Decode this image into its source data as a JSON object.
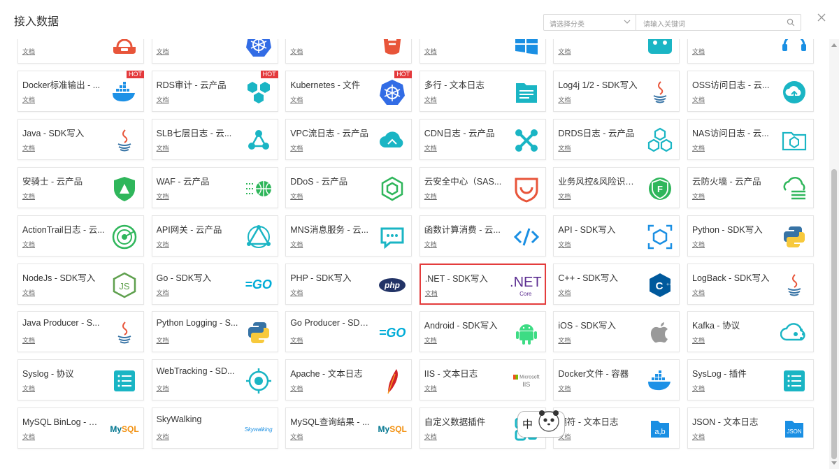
{
  "dialog": {
    "title": "接入数据",
    "category_placeholder": "请选择分类",
    "search_placeholder": "请输入关键词"
  },
  "ime": {
    "label": "中"
  },
  "hot_label": "HOT",
  "cards": [
    {
      "name": "",
      "doc": "文档",
      "icon": "alarm-icon",
      "color": "#e8553a"
    },
    {
      "name": "",
      "doc": "文档",
      "icon": "kubernetes-icon",
      "color": "#326ce5"
    },
    {
      "name": "",
      "doc": "文档",
      "icon": "bucket-icon",
      "color": "#e8553a"
    },
    {
      "name": "",
      "doc": "文档",
      "icon": "windows-icon",
      "color": "#1a8fe3"
    },
    {
      "name": "",
      "doc": "文档",
      "icon": "cloud-box-icon",
      "color": "#1ab5c4"
    },
    {
      "name": "",
      "doc": "文档",
      "icon": "headset-icon",
      "color": "#1a8fe3"
    },
    {
      "name": "Docker标准输出 - ...",
      "doc": "文档",
      "icon": "docker-icon",
      "color": "#1d91e6",
      "hot": true
    },
    {
      "name": "RDS审计 - 云产品",
      "doc": "文档",
      "icon": "hexagons-icon",
      "color": "#1ab5c4",
      "hot": true
    },
    {
      "name": "Kubernetes - 文件",
      "doc": "文档",
      "icon": "kubernetes-icon",
      "color": "#326ce5",
      "hot": true
    },
    {
      "name": "多行 - 文本日志",
      "doc": "文档",
      "icon": "file-lines-icon",
      "color": "#1ab5c4"
    },
    {
      "name": "Log4j 1/2 - SDK写入",
      "doc": "文档",
      "icon": "java-icon",
      "color": "#e8553a"
    },
    {
      "name": "OSS访问日志 - 云...",
      "doc": "文档",
      "icon": "cloud-upload-icon",
      "color": "#1ab5c4"
    },
    {
      "name": "Java - SDK写入",
      "doc": "文档",
      "icon": "java-icon",
      "color": "#e8553a"
    },
    {
      "name": "SLB七层日志 - 云...",
      "doc": "文档",
      "icon": "nodes-icon",
      "color": "#1ab5c4"
    },
    {
      "name": "VPC流日志 - 云产品",
      "doc": "文档",
      "icon": "cloud-flow-icon",
      "color": "#1ab5c4"
    },
    {
      "name": "CDN日志 - 云产品",
      "doc": "文档",
      "icon": "cross-nodes-icon",
      "color": "#1ab5c4"
    },
    {
      "name": "DRDS日志 - 云产品",
      "doc": "文档",
      "icon": "hexagon-stack-icon",
      "color": "#1ab5c4"
    },
    {
      "name": "NAS访问日志 - 云...",
      "doc": "文档",
      "icon": "folder-icon",
      "color": "#1ab5c4"
    },
    {
      "name": "安骑士 - 云产品",
      "doc": "文档",
      "icon": "shield-icon",
      "color": "#2fb65b"
    },
    {
      "name": "WAF - 云产品",
      "doc": "文档",
      "icon": "firewall-icon",
      "color": "#2fb65b"
    },
    {
      "name": "DDoS - 云产品",
      "doc": "文档",
      "icon": "cube-icon",
      "color": "#2fb65b"
    },
    {
      "name": "云安全中心（SAS...",
      "doc": "文档",
      "icon": "security-badge-icon",
      "color": "#e8553a"
    },
    {
      "name": "业务风控&风险识别...",
      "doc": "文档",
      "icon": "risk-shield-icon",
      "color": "#2fb65b"
    },
    {
      "name": "云防火墙 - 云产品",
      "doc": "文档",
      "icon": "cloud-firewall-icon",
      "color": "#2fb65b"
    },
    {
      "name": "ActionTrail日志 - 云...",
      "doc": "文档",
      "icon": "radar-icon",
      "color": "#2fb65b"
    },
    {
      "name": "API网关 - 云产品",
      "doc": "文档",
      "icon": "triangle-nodes-icon",
      "color": "#1ab5c4"
    },
    {
      "name": "MNS消息服务 - 云...",
      "doc": "文档",
      "icon": "message-icon",
      "color": "#1ab5c4"
    },
    {
      "name": "函数计算消费 - 云...",
      "doc": "文档",
      "icon": "function-icon",
      "color": "#1a8fe3"
    },
    {
      "name": "API - SDK写入",
      "doc": "文档",
      "icon": "api-cube-icon",
      "color": "#1a8fe3"
    },
    {
      "name": "Python - SDK写入",
      "doc": "文档",
      "icon": "python-icon",
      "color": "#3773a5"
    },
    {
      "name": "NodeJs - SDK写入",
      "doc": "文档",
      "icon": "nodejs-icon",
      "color": "#5fa04e"
    },
    {
      "name": "Go - SDK写入",
      "doc": "文档",
      "icon": "go-icon",
      "color": "#00acd7",
      "text": "=GO"
    },
    {
      "name": "PHP - SDK写入",
      "doc": "文档",
      "icon": "php-icon",
      "color": "#223366",
      "text": "php"
    },
    {
      "name": ".NET - SDK写入",
      "doc": "文档",
      "icon": "dotnet-icon",
      "color": "#5c2d91",
      "text": ".NET",
      "sub": "Core",
      "selected": true
    },
    {
      "name": "C++ - SDK写入",
      "doc": "文档",
      "icon": "cplusplus-icon",
      "color": "#00599c"
    },
    {
      "name": "LogBack - SDK写入",
      "doc": "文档",
      "icon": "java-icon",
      "color": "#e8553a"
    },
    {
      "name": "Java Producer - S...",
      "doc": "文档",
      "icon": "java-icon",
      "color": "#e8553a"
    },
    {
      "name": "Python Logging - S...",
      "doc": "文档",
      "icon": "python-icon",
      "color": "#3773a5"
    },
    {
      "name": "Go Producer - SDK...",
      "doc": "文档",
      "icon": "go-icon",
      "color": "#00acd7",
      "text": "=GO"
    },
    {
      "name": "Android - SDK写入",
      "doc": "文档",
      "icon": "android-icon",
      "color": "#3ddc84"
    },
    {
      "name": "iOS - SDK写入",
      "doc": "文档",
      "icon": "apple-icon",
      "color": "#9a9a9a"
    },
    {
      "name": "Kafka - 协议",
      "doc": "文档",
      "icon": "kafka-cloud-icon",
      "color": "#1ab5c4"
    },
    {
      "name": "Syslog - 协议",
      "doc": "文档",
      "icon": "list-icon",
      "color": "#1ab5c4"
    },
    {
      "name": "WebTracking - SD...",
      "doc": "文档",
      "icon": "target-icon",
      "color": "#1ab5c4"
    },
    {
      "name": "Apache - 文本日志",
      "doc": "文档",
      "icon": "feather-icon",
      "color": "#d22128"
    },
    {
      "name": "IIS - 文本日志",
      "doc": "文档",
      "icon": "microsoft-iis-icon",
      "color": "#737373",
      "text": "Microsoft",
      "sub": "IIS"
    },
    {
      "name": "Docker文件 - 容器",
      "doc": "文档",
      "icon": "docker-icon",
      "color": "#1d91e6"
    },
    {
      "name": "SysLog - 插件",
      "doc": "文档",
      "icon": "list-icon",
      "color": "#1ab5c4"
    },
    {
      "name": "MySQL BinLog - 插件",
      "doc": "文档",
      "icon": "mysql-icon",
      "color": "#00758f",
      "text": "MySQL"
    },
    {
      "name": "SkyWalking",
      "doc": "文档",
      "icon": "skywalking-icon",
      "color": "#1a8fe3",
      "text": "Skywalking"
    },
    {
      "name": "MySQL查询结果 - ...",
      "doc": "文档",
      "icon": "mysql-icon",
      "color": "#00758f",
      "text": "MySQL"
    },
    {
      "name": "自定义数据插件",
      "doc": "文档",
      "icon": "plugin-icon",
      "color": "#1ab5c4"
    },
    {
      "name": "隔符 - 文本日志",
      "doc": "文档",
      "icon": "ab-icon",
      "color": "#1a8fe3",
      "text": "a,b"
    },
    {
      "name": "JSON - 文本日志",
      "doc": "文档",
      "icon": "json-icon",
      "color": "#1a8fe3",
      "text": "JSON"
    }
  ]
}
